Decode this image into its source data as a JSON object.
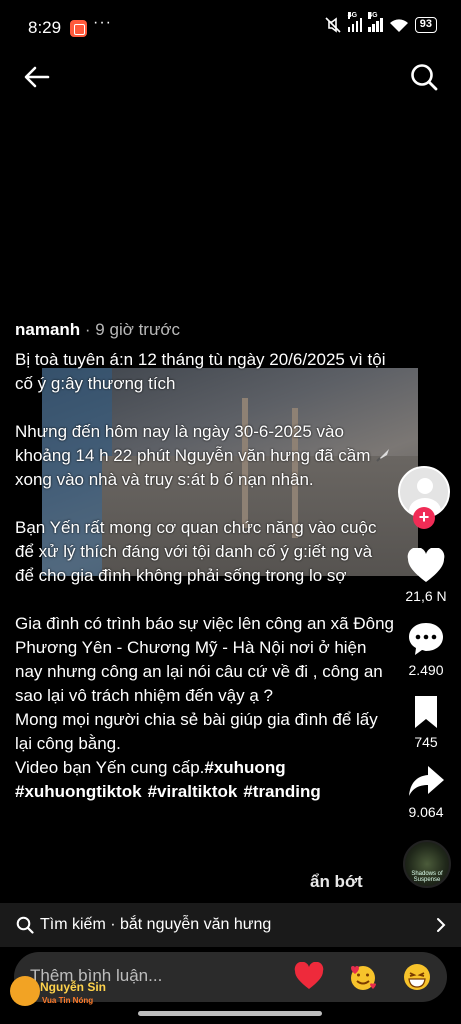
{
  "status": {
    "time": "8:29",
    "dots": "···",
    "network_1": "4G",
    "network_2": "4G",
    "battery": "93"
  },
  "post": {
    "author": "namanh",
    "time_ago": "· 9 giờ trước",
    "paragraphs": [
      "Bị toà tuyên á:n 12 tháng tù ngày 20/6/2025 vì tội cố ý g:ây thương tích",
      "Nhưng đến hôm nay là ngày 30-6-2025 vào khoảng 14 h 22 phút Nguyễn văn hưng đã cầm",
      "xong vào nhà và truy s:át b ố nạn nhân.",
      "Bạn Yến rất mong cơ quan chức năng vào cuộc để xử lý thích đáng với tội danh cố ý g:iết ng và để cho gia đình không phải sống trong lo sợ",
      "Gia đình có trình báo sự việc lên công an xã Đông Phương Yên - Chương Mỹ - Hà Nội nơi ở hiện nay nhưng công an lại nói câu cứ về đi , công an sao lại vô trách nhiệm đến vậy ạ ?",
      "Mong mọi người chia sẻ bài giúp gia đình để lấy lại công bằng.",
      "Video bạn Yến cung cấp."
    ],
    "hashtags": [
      "#xuhuong",
      "#xuhuongtiktok",
      "#viraltiktok",
      "#tranding"
    ],
    "less_label": "ẩn bớt"
  },
  "rail": {
    "likes": "21,6 N",
    "comments": "2.490",
    "saves": "745",
    "shares": "9.064",
    "music_label": "Shadows of Suspense"
  },
  "search_bar": {
    "label": "Tìm kiếm · bắt nguyễn văn hưng"
  },
  "comment_bar": {
    "placeholder": "Thêm bình luận..."
  },
  "watermark": {
    "name": "Nguyễn Sin",
    "sub": "Vua Tin Nóng"
  },
  "colors": {
    "accent": "#f02c56",
    "background": "#000000",
    "search_bg": "#1a1a1a"
  }
}
